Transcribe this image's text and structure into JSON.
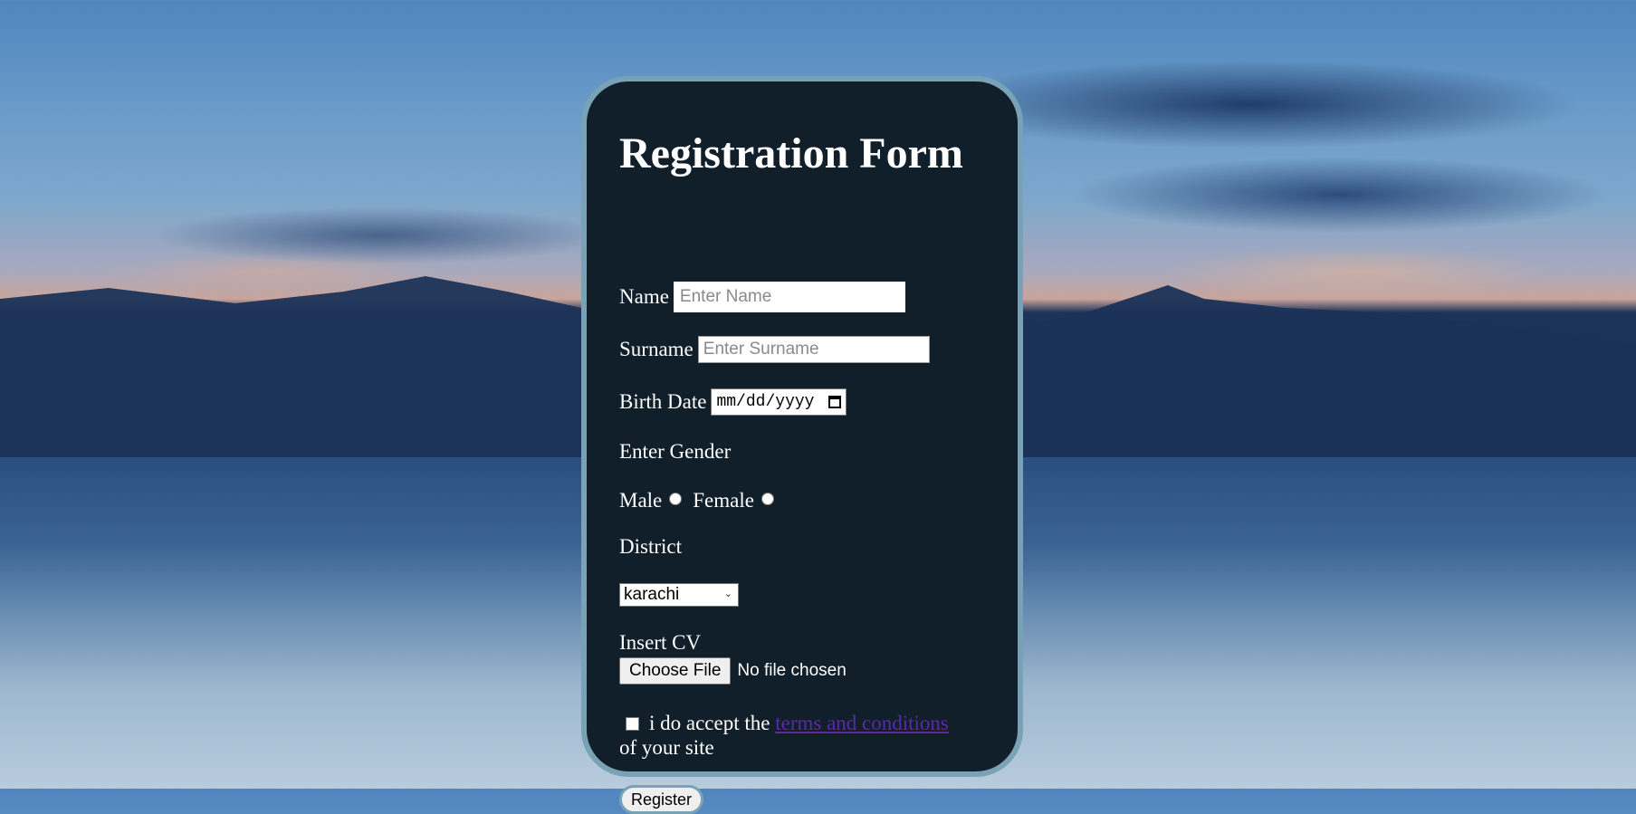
{
  "form": {
    "title": "Registration Form",
    "name_label": "Name",
    "name_placeholder": "Enter Name",
    "surname_label": "Surname",
    "surname_placeholder": "Enter Surname",
    "birth_date_label": "Birth Date",
    "birth_date_placeholder": "mm/dd/yyyy",
    "gender_label": "Enter Gender",
    "male_label": "Male",
    "female_label": "Female",
    "district_label": "District",
    "district_selected": "karachi",
    "cv_label": "Insert CV",
    "file_button_label": "Choose File",
    "file_status": "No file chosen",
    "terms_prefix": "i do accept the",
    "terms_link": "terms and conditions",
    "terms_suffix": "of your site",
    "register_label": "Register"
  },
  "colors": {
    "card_background": "#111f2b",
    "card_border": "#7aa2b6",
    "link": "#5a2aa3"
  }
}
